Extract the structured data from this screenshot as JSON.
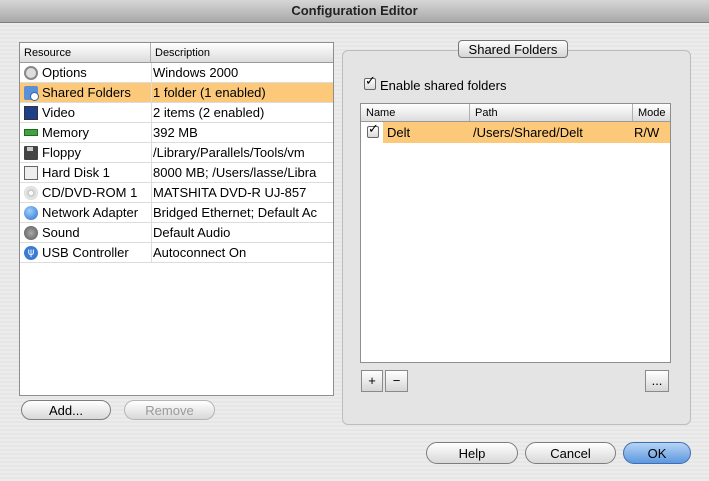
{
  "window": {
    "title": "Configuration Editor"
  },
  "resources": {
    "columns": [
      "Resource",
      "Description"
    ],
    "rows": [
      {
        "icon": "options-icon",
        "name": "Options",
        "description": "Windows 2000",
        "selected": false
      },
      {
        "icon": "shared-folders-icon",
        "name": "Shared Folders",
        "description": "1 folder (1 enabled)",
        "selected": true
      },
      {
        "icon": "video-icon",
        "name": "Video",
        "description": "2 items (2 enabled)",
        "selected": false
      },
      {
        "icon": "memory-icon",
        "name": "Memory",
        "description": "392 MB",
        "selected": false
      },
      {
        "icon": "floppy-icon",
        "name": "Floppy",
        "description": "/Library/Parallels/Tools/vm",
        "selected": false
      },
      {
        "icon": "hard-disk-icon",
        "name": "Hard Disk 1",
        "description": "8000 MB; /Users/lasse/Libra",
        "selected": false
      },
      {
        "icon": "cd-dvd-icon",
        "name": "CD/DVD-ROM 1",
        "description": "MATSHITA DVD-R   UJ-857",
        "selected": false
      },
      {
        "icon": "network-icon",
        "name": "Network Adapter",
        "description": "Bridged Ethernet; Default Ac",
        "selected": false
      },
      {
        "icon": "sound-icon",
        "name": "Sound",
        "description": "Default Audio",
        "selected": false
      },
      {
        "icon": "usb-icon",
        "name": "USB Controller",
        "description": "Autoconnect On",
        "selected": false
      }
    ],
    "add_label": "Add...",
    "remove_label": "Remove"
  },
  "shared": {
    "group_title": "Shared Folders",
    "enable_label": "Enable shared folders",
    "enable_checked": true,
    "columns": [
      "Name",
      "Path",
      "Mode"
    ],
    "folders": [
      {
        "checked": true,
        "name": "Delt",
        "path": "/Users/Shared/Delt",
        "mode": "R/W"
      }
    ],
    "plus_label": "+",
    "minus_label": "−",
    "more_label": "..."
  },
  "footer": {
    "help_label": "Help",
    "cancel_label": "Cancel",
    "ok_label": "OK"
  },
  "colors": {
    "selection": "#fcc87a",
    "default_button": "#5d97df"
  }
}
